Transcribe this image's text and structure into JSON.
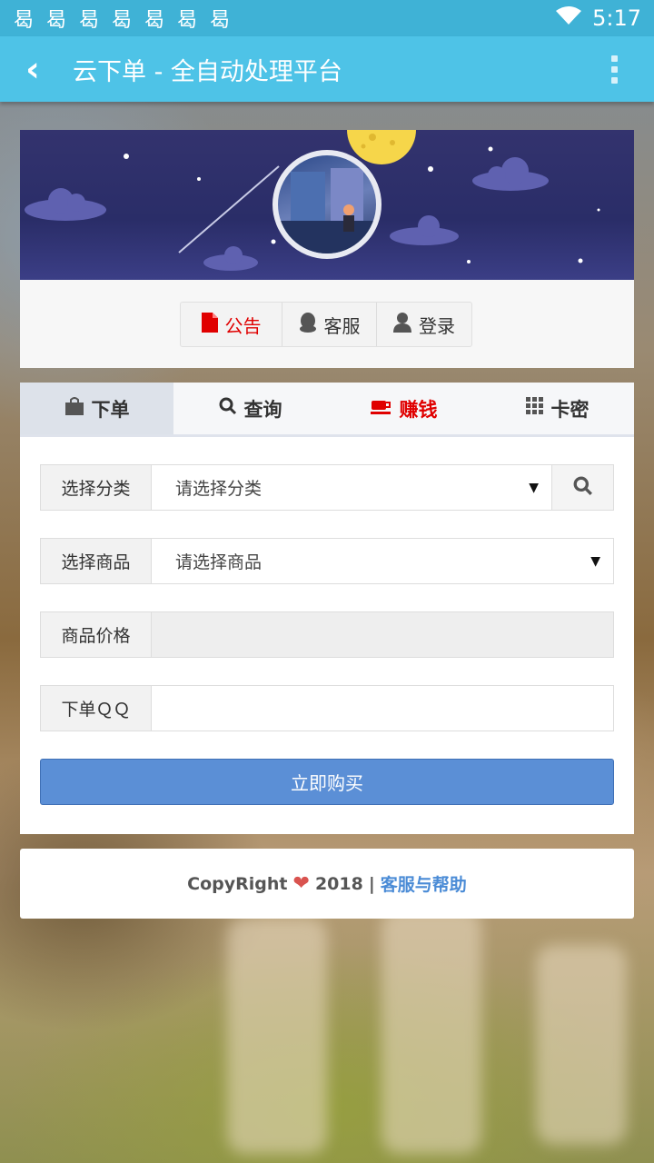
{
  "status_bar": {
    "notification_icons": [
      "曷",
      "曷",
      "曷",
      "曷",
      "曷",
      "曷",
      "曷"
    ],
    "time": "5:17"
  },
  "app_bar": {
    "back_icon": "‹",
    "title": "云下单 - 全自动处理平台"
  },
  "header": {
    "buttons": [
      {
        "label": "公告",
        "icon": "file-icon"
      },
      {
        "label": "客服",
        "icon": "qq-icon"
      },
      {
        "label": "登录",
        "icon": "user-icon"
      }
    ]
  },
  "tabs": [
    {
      "label": "下单",
      "icon": "bag-icon"
    },
    {
      "label": "查询",
      "icon": "search-icon"
    },
    {
      "label": "赚钱",
      "icon": "coffee-icon"
    },
    {
      "label": "卡密",
      "icon": "grid-icon"
    }
  ],
  "form": {
    "category_label": "选择分类",
    "category_value": "请选择分类",
    "product_label": "选择商品",
    "product_value": "请选择商品",
    "price_label": "商品价格",
    "price_value": "",
    "qq_label": "下单ＱＱ",
    "qq_value": "",
    "buy_button": "立即购买"
  },
  "footer": {
    "copyright": "CopyRight",
    "year": "2018",
    "separator": "|",
    "link": "客服与帮助"
  },
  "colors": {
    "app_bar": "#4ec3e7",
    "status_bar": "#3fb2d6",
    "accent_red": "#e00000",
    "buy_button": "#5b8fd6",
    "link": "#4a8bd6"
  }
}
